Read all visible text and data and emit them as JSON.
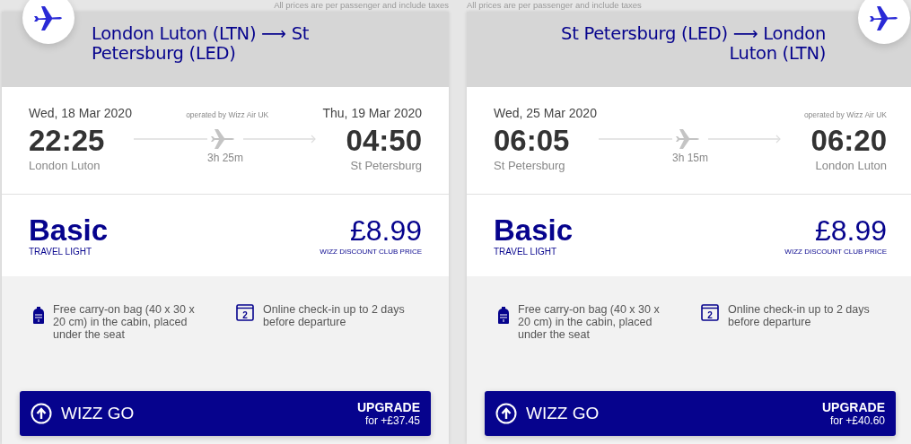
{
  "cards": [
    {
      "kind": "outbound",
      "note": "All prices are per passenger and include taxes",
      "route": "London Luton (LTN) ⟶ St Petersburg (LED)",
      "departure": {
        "date": "Wed, 18 Mar 2020",
        "time": "22:25",
        "city": "London Luton"
      },
      "operator": "operated by Wizz Air UK",
      "arrival": {
        "date": "Thu, 19 Mar 2020",
        "time": "04:50",
        "city": "St Petersburg"
      },
      "duration": "3h 25m",
      "fare": {
        "name": "Basic",
        "tagline": "TRAVEL LIGHT",
        "price": "£8.99",
        "price_label": "WIZZ DISCOUNT CLUB PRICE"
      },
      "features": [
        {
          "kind": "bag",
          "text": "Free carry-on bag (40 x 30 x 20 cm) in the cabin, placed under the seat"
        },
        {
          "kind": "calendar",
          "icon_text": "2",
          "text": "Online check-in up to 2 days before departure"
        }
      ],
      "upgrade": {
        "name": "WIZZ GO",
        "action": "UPGRADE",
        "price": "for +£37.45"
      }
    },
    {
      "kind": "return",
      "note": "All prices are per passenger and include taxes",
      "route": "St Petersburg (LED) ⟶ London Luton (LTN)",
      "departure": {
        "date": "Wed, 25 Mar 2020",
        "time": "06:05",
        "city": "St Petersburg"
      },
      "operator": "operated by Wizz Air UK",
      "arrival": {
        "time": "06:20",
        "city": "London Luton"
      },
      "duration": "3h 15m",
      "fare": {
        "name": "Basic",
        "tagline": "TRAVEL LIGHT",
        "price": "£8.99",
        "price_label": "WIZZ DISCOUNT CLUB PRICE"
      },
      "features": [
        {
          "kind": "bag",
          "text": "Free carry-on bag (40 x 30 x 20 cm) in the cabin, placed under the seat"
        },
        {
          "kind": "calendar",
          "icon_text": "2",
          "text": "Online check-in up to 2 days before departure"
        }
      ],
      "upgrade": {
        "name": "WIZZ GO",
        "action": "UPGRADE",
        "price": "for +£40.60"
      }
    }
  ]
}
